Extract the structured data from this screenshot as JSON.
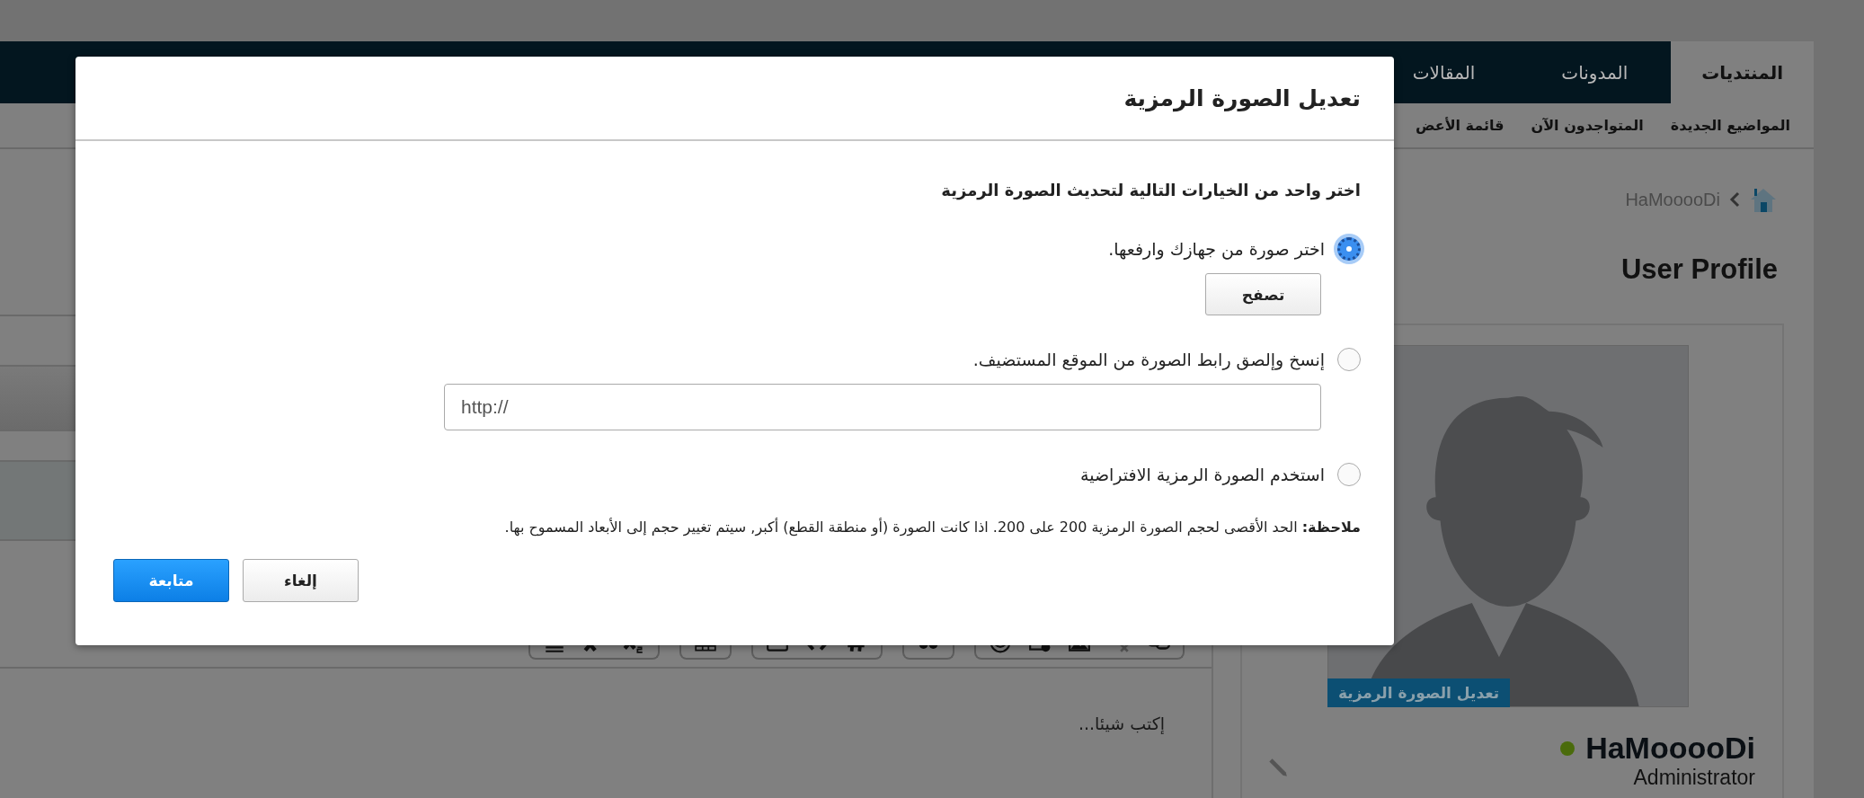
{
  "nav": {
    "tabs": [
      {
        "label": "المنتديات",
        "selected": true
      },
      {
        "label": "المدونات",
        "selected": false
      },
      {
        "label": "المقالات",
        "selected": false
      }
    ],
    "subnav": [
      "المواضيع الجديدة",
      "المتواجدون الآن",
      "قائمة الأعض"
    ]
  },
  "breadcrumb": {
    "current": "HaMooooDi"
  },
  "page_title": "User Profile",
  "profile": {
    "avatar_badge": "تعديل الصورة الرمزية",
    "username": "HaMooooDi",
    "online": true,
    "role": "Administrator"
  },
  "editor": {
    "placeholder": "إكتب شيئا..."
  },
  "dialog": {
    "title": "تعديل الصورة الرمزية",
    "instruction": "اختر واحد من الخيارات التالية لتحديث الصورة الرمزية",
    "options": [
      {
        "kind": "upload",
        "label": "اختر صورة من جهازك وارفعها.",
        "selected": true,
        "button": "تصفح"
      },
      {
        "kind": "url",
        "label": "إنسخ وإلصق رابط الصورة من الموقع المستضيف.",
        "selected": false,
        "value": "http://"
      },
      {
        "kind": "default",
        "label": "استخدم الصورة الرمزية الافتراضية",
        "selected": false
      }
    ],
    "note": "**ملاحظة:** الحد الأقصى لحجم الصورة الرمزية 200 على 200. اذا كانت الصورة (أو منطقة القطع) أكبر, سيتم تغيير حجم إلى الأبعاد المسموح بها.",
    "buttons": [
      {
        "label": "إلغاء",
        "kind": "secondary"
      },
      {
        "label": "متابعة",
        "kind": "primary"
      }
    ]
  }
}
